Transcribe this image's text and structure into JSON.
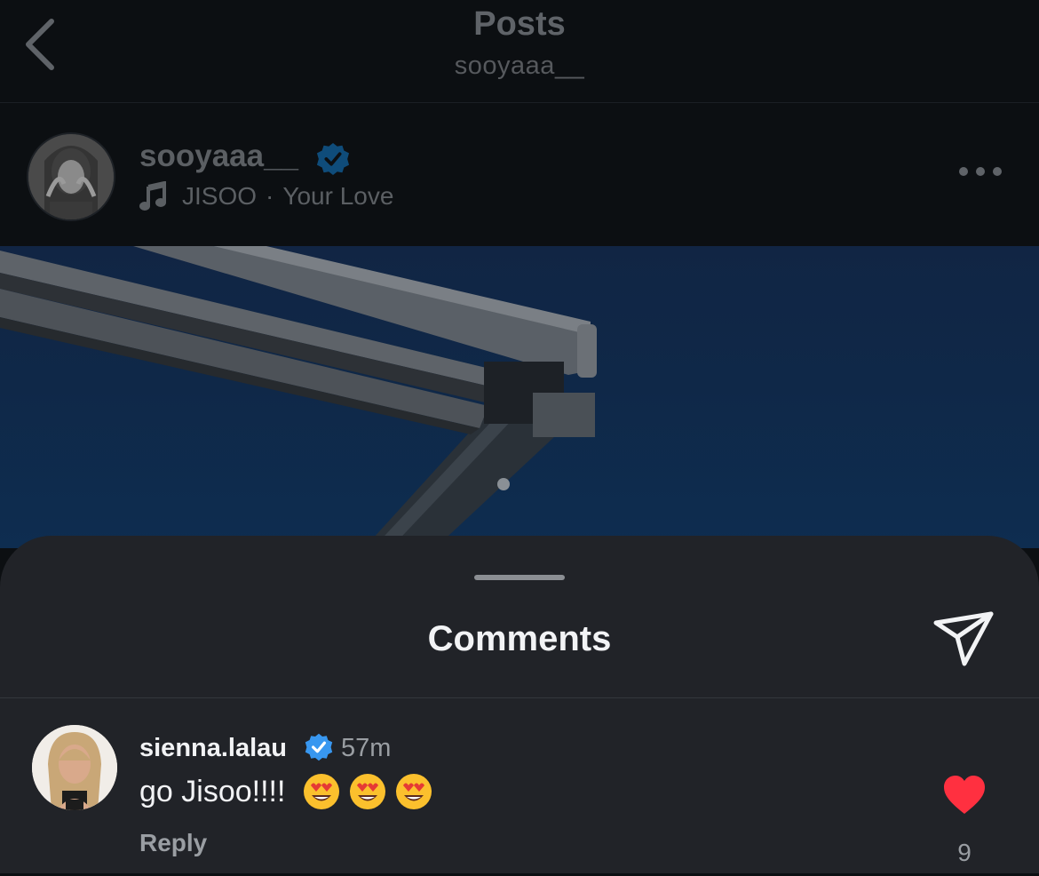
{
  "header": {
    "title": "Posts",
    "subtitle": "sooyaaa__",
    "back_icon": "chevron-left-icon"
  },
  "post": {
    "username": "sooyaaa__",
    "verified": true,
    "music_artist": "JISOO",
    "music_separator": "·",
    "music_track": "Your Love",
    "more_icon": "more-horizontal-icon"
  },
  "comments_sheet": {
    "title": "Comments",
    "share_icon": "paper-plane-icon",
    "items": [
      {
        "username": "sienna.lalau",
        "verified": true,
        "time": "57m",
        "text": "go Jisoo!!!!",
        "emojis": [
          "heart-eyes-emoji",
          "heart-eyes-emoji",
          "heart-eyes-emoji"
        ],
        "reply_label": "Reply",
        "liked": true,
        "like_count": "9"
      }
    ]
  },
  "colors": {
    "sheet_bg": "#212328",
    "verified_blue": "#3897f0",
    "heart_red": "#ff3040",
    "text_primary": "#f2f3f5",
    "text_secondary": "#9a9ea3"
  }
}
